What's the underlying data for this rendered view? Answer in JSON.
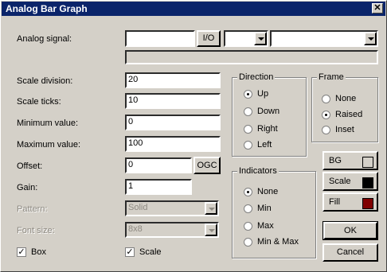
{
  "window": {
    "title": "Analog Bar Graph",
    "close_icon": "close-icon"
  },
  "analog_signal": {
    "label": "Analog signal:",
    "value": "",
    "io_button": "I/O",
    "combo1_value": "",
    "combo2_value": "",
    "bar_value": ""
  },
  "scale_division": {
    "label": "Scale division:",
    "value": "20"
  },
  "scale_ticks": {
    "label": "Scale ticks:",
    "value": "10"
  },
  "minimum_value": {
    "label": "Minimum value:",
    "value": "0"
  },
  "maximum_value": {
    "label": "Maximum value:",
    "value": "100"
  },
  "offset": {
    "label": "Offset:",
    "value": "0",
    "ogc_button": "OGC"
  },
  "gain": {
    "label": "Gain:",
    "value": "1"
  },
  "pattern": {
    "label": "Pattern:",
    "value": "Solid"
  },
  "font_size": {
    "label": "Font size:",
    "value": "8x8"
  },
  "box": {
    "label": "Box",
    "checked": true
  },
  "scale_check": {
    "label": "Scale",
    "checked": true
  },
  "direction": {
    "title": "Direction",
    "options": [
      {
        "label": "Up",
        "selected": true
      },
      {
        "label": "Down",
        "selected": false
      },
      {
        "label": "Right",
        "selected": false
      },
      {
        "label": "Left",
        "selected": false
      }
    ]
  },
  "frame": {
    "title": "Frame",
    "options": [
      {
        "label": "None",
        "selected": false
      },
      {
        "label": "Raised",
        "selected": true
      },
      {
        "label": "Inset",
        "selected": false
      }
    ]
  },
  "indicators": {
    "title": "Indicators",
    "options": [
      {
        "label": "None",
        "selected": true
      },
      {
        "label": "Min",
        "selected": false
      },
      {
        "label": "Max",
        "selected": false
      },
      {
        "label": "Min & Max",
        "selected": false
      }
    ]
  },
  "colors": {
    "bg": {
      "label": "BG",
      "color": "#d4d0c8"
    },
    "scale": {
      "label": "Scale",
      "color": "#000000"
    },
    "fill": {
      "label": "Fill",
      "color": "#800000"
    }
  },
  "ok_button": "OK",
  "cancel_button": "Cancel"
}
